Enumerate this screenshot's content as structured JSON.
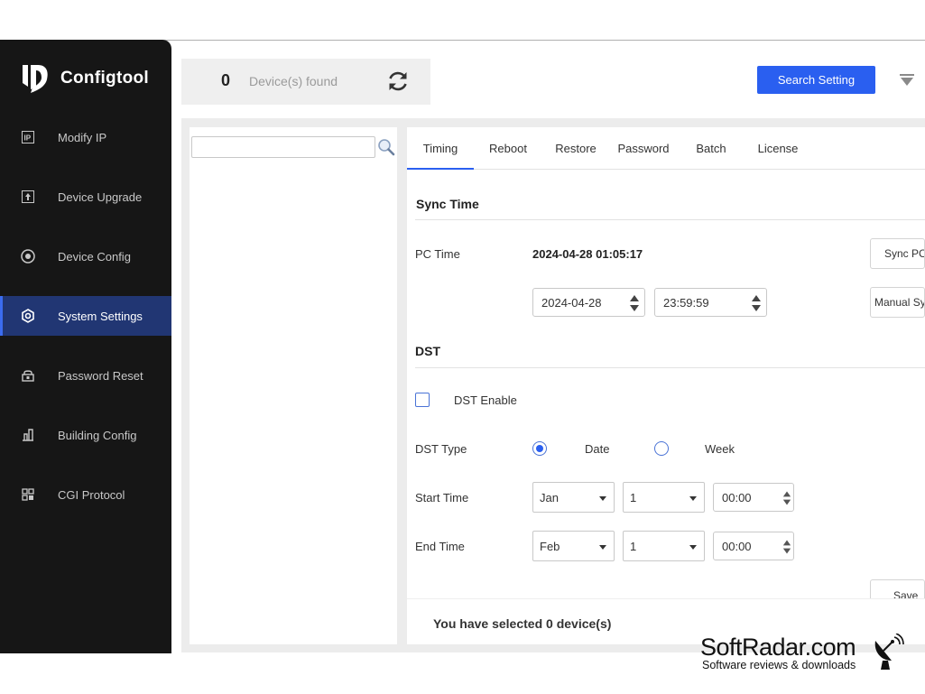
{
  "app": {
    "name": "Configtool"
  },
  "sidebar": {
    "items": [
      {
        "label": "Modify IP",
        "icon": "ip-icon",
        "active": false
      },
      {
        "label": "Device Upgrade",
        "icon": "upgrade-icon",
        "active": false
      },
      {
        "label": "Device Config",
        "icon": "config-icon",
        "active": false
      },
      {
        "label": "System Settings",
        "icon": "settings-icon",
        "active": true
      },
      {
        "label": "Password Reset",
        "icon": "lock-icon",
        "active": false
      },
      {
        "label": "Building Config",
        "icon": "building-icon",
        "active": false
      },
      {
        "label": "CGI Protocol",
        "icon": "grid-icon",
        "active": false
      }
    ]
  },
  "header": {
    "device_count": "0",
    "device_label": "Device(s) found",
    "search_setting_label": "Search Setting"
  },
  "left_panel": {
    "search_value": "",
    "search_placeholder": ""
  },
  "tabs": [
    {
      "label": "Timing",
      "active": true
    },
    {
      "label": "Reboot",
      "active": false
    },
    {
      "label": "Restore",
      "active": false
    },
    {
      "label": "Password",
      "active": false
    },
    {
      "label": "Batch",
      "active": false
    },
    {
      "label": "License",
      "active": false
    }
  ],
  "sync_time": {
    "title": "Sync Time",
    "pc_time_label": "PC Time",
    "pc_time_value": "2024-04-28 01:05:17",
    "sync_pc_button": "Sync PC",
    "date_value": "2024-04-28",
    "time_value": "23:59:59",
    "manual_sync_button": "Manual Sy"
  },
  "dst": {
    "title": "DST",
    "enable_label": "DST Enable",
    "enabled": false,
    "type_label": "DST Type",
    "type_options": [
      "Date",
      "Week"
    ],
    "type_selected": "Date",
    "start_label": "Start Time",
    "start_month": "Jan",
    "start_day": "1",
    "start_time": "00:00",
    "end_label": "End Time",
    "end_month": "Feb",
    "end_day": "1",
    "end_time": "00:00",
    "save_button": "Save"
  },
  "footer": {
    "selected_text": "You have selected 0 device(s)"
  },
  "watermark": {
    "title": "SoftRadar.com",
    "subtitle": "Software reviews & downloads"
  },
  "colors": {
    "sidebar_bg": "#161616",
    "active_item_bg": "#213673",
    "accent": "#2a5ff0"
  }
}
